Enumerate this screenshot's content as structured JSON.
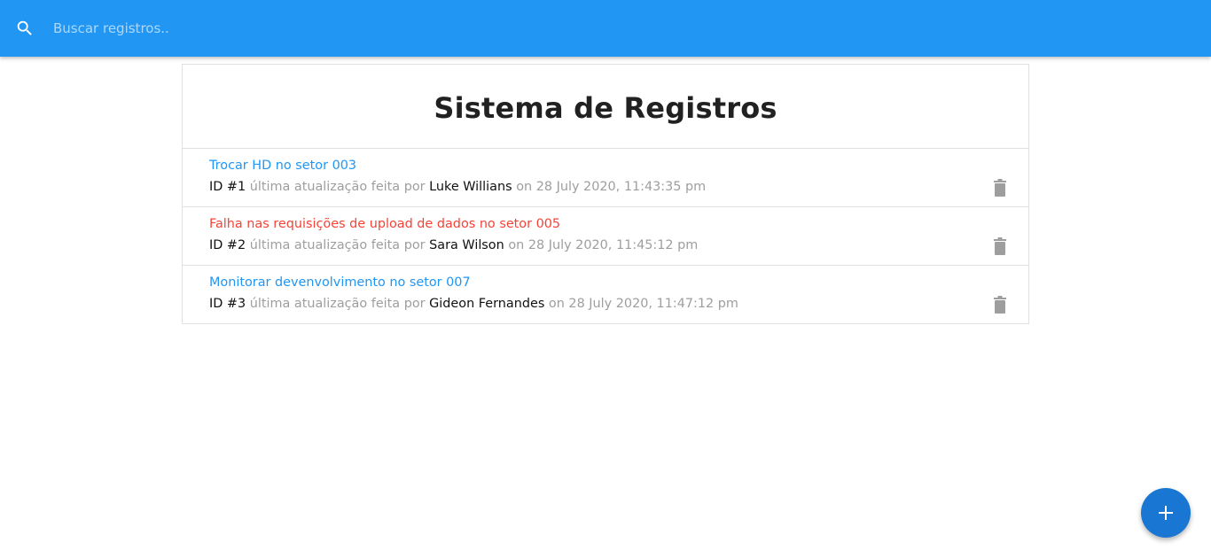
{
  "search": {
    "placeholder": "Buscar registros.."
  },
  "page_title": "Sistema de Registros",
  "records": [
    {
      "title": "Trocar HD no setor 003",
      "alert": false,
      "id_label": "ID #1",
      "update_text": "última atualização feita por",
      "author": "Luke Willians",
      "date_text": "on 28 July 2020, 11:43:35 pm"
    },
    {
      "title": "Falha nas requisições de upload de dados no setor 005",
      "alert": true,
      "id_label": "ID #2",
      "update_text": "última atualização feita por",
      "author": "Sara Wilson",
      "date_text": "on 28 July 2020, 11:45:12 pm"
    },
    {
      "title": "Monitorar devenvolvimento no setor 007",
      "alert": false,
      "id_label": "ID #3",
      "update_text": "última atualização feita por",
      "author": "Gideon Fernandes",
      "date_text": "on 28 July 2020, 11:47:12 pm"
    }
  ],
  "icons": {
    "search": "search-icon",
    "delete": "trash-icon",
    "add": "add-icon"
  },
  "colors": {
    "appbar": "#2196f3",
    "link": "#2196f3",
    "alert": "#f44336",
    "fab": "#1976d2",
    "muted": "#9e9e9e"
  }
}
